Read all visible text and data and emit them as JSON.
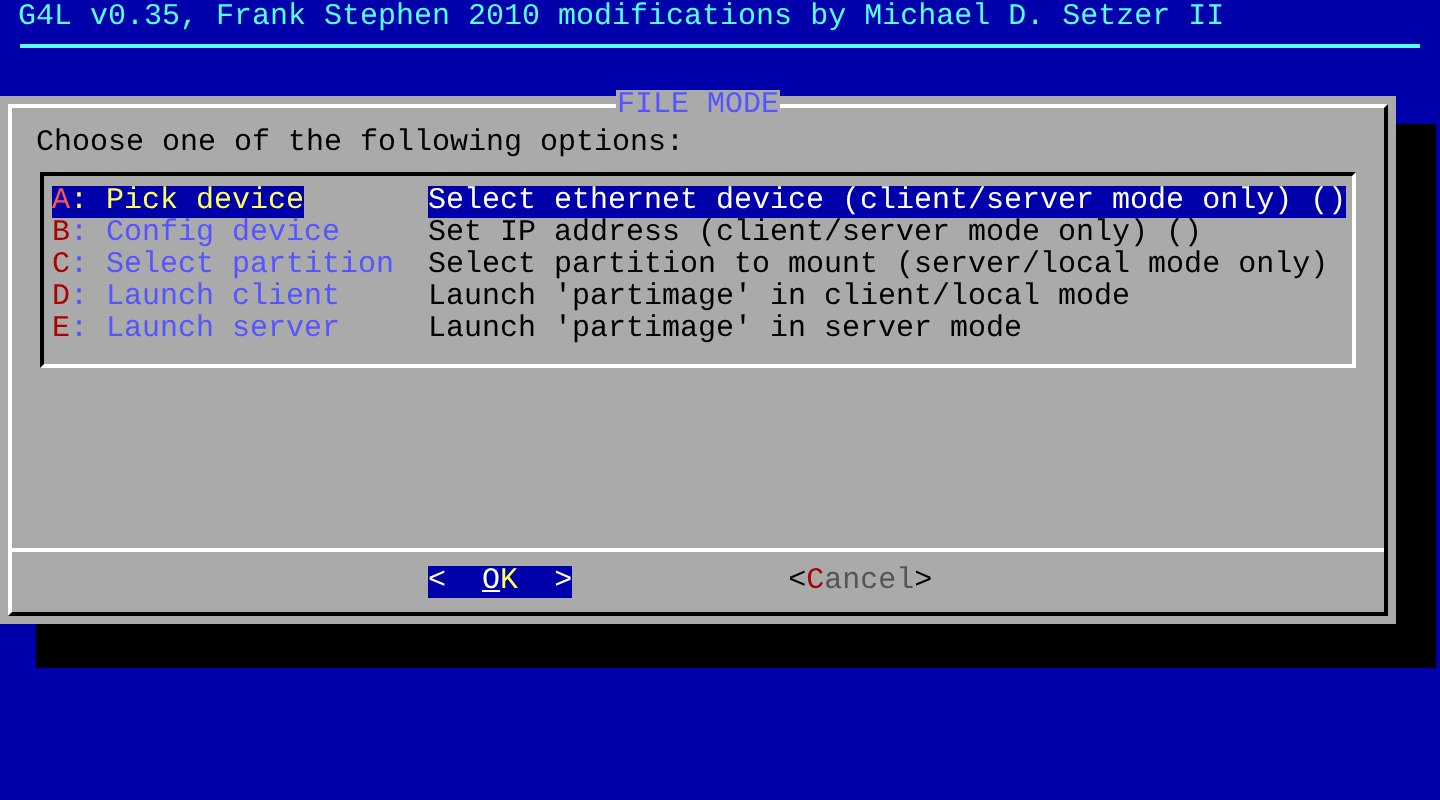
{
  "backtitle": "G4L v0.35, Frank Stephen 2010 modifications by Michael D. Setzer II",
  "dialog": {
    "title": "FILE MODE",
    "prompt": "Choose one of the following options:"
  },
  "menu": [
    {
      "label": "A: Pick device",
      "description": "Select ethernet device (client/server mode only) ()",
      "selected": true
    },
    {
      "label": "B: Config device",
      "description": "Set IP address (client/server mode only) ()",
      "selected": false
    },
    {
      "label": "C: Select partition",
      "description": "Select partition to mount (server/local mode only)",
      "selected": false
    },
    {
      "label": "D: Launch client",
      "description": "Launch 'partimage' in client/local mode",
      "selected": false
    },
    {
      "label": "E: Launch server",
      "description": "Launch 'partimage' in server mode",
      "selected": false
    }
  ],
  "buttons": [
    {
      "open": "<",
      "label": "OK",
      "close": ">",
      "selected": true
    },
    {
      "open": "<",
      "label": "Cancel",
      "close": ">",
      "selected": false
    }
  ]
}
